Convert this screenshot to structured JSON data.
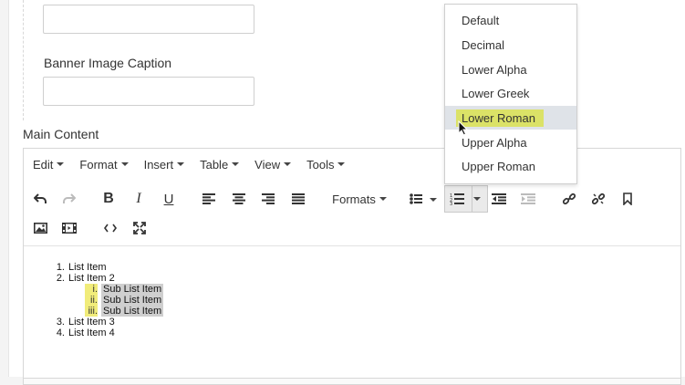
{
  "form": {
    "banner_caption_label": "Banner Image Caption",
    "main_content_label": "Main Content"
  },
  "menubar": [
    {
      "label": "Edit"
    },
    {
      "label": "Format"
    },
    {
      "label": "Insert"
    },
    {
      "label": "Table"
    },
    {
      "label": "View"
    },
    {
      "label": "Tools"
    }
  ],
  "toolbar": {
    "formats_label": "Formats",
    "icons": [
      "undo-icon",
      "redo-icon",
      "bold-icon",
      "italic-icon",
      "underline-icon",
      "align-left-icon",
      "align-center-icon",
      "align-right-icon",
      "align-justify-icon",
      "bullet-list-icon",
      "numbered-list-icon",
      "outdent-icon",
      "indent-icon",
      "link-icon",
      "unlink-icon",
      "bookmark-icon",
      "image-icon",
      "media-icon",
      "code-icon",
      "fullscreen-icon"
    ]
  },
  "content": {
    "items": [
      {
        "num": "1.",
        "text": "List Item"
      },
      {
        "num": "2.",
        "text": "List Item 2"
      },
      {
        "num": "i.",
        "text": "Sub List Item",
        "sub": true
      },
      {
        "num": "ii.",
        "text": "Sub List Item",
        "sub": true
      },
      {
        "num": "iii.",
        "text": "Sub List Item",
        "sub": true
      },
      {
        "num": "3.",
        "text": "List Item 3"
      },
      {
        "num": "4.",
        "text": "List Item 4"
      }
    ]
  },
  "list_style_dropdown": {
    "options": [
      "Default",
      "Decimal",
      "Lower Alpha",
      "Lower Greek",
      "Lower Roman",
      "Upper Alpha",
      "Upper Roman"
    ],
    "highlighted": "Lower Roman"
  },
  "colors": {
    "highlight_yellow": "#dbe267",
    "selection_gray": "#cfcfcf",
    "active_option_bg": "#dfe3e8"
  }
}
